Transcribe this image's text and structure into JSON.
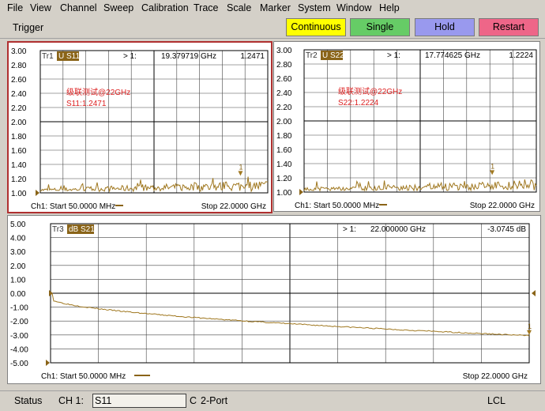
{
  "menu": [
    "File",
    "View",
    "Channel",
    "Sweep",
    "Calibration",
    "Trace",
    "Scale",
    "Marker",
    "System",
    "Window",
    "Help"
  ],
  "toolbar": {
    "trigger_label": "Trigger",
    "buttons": [
      {
        "label": "Continuous",
        "color": "#ffff00"
      },
      {
        "label": "Single",
        "color": "#66cc66"
      },
      {
        "label": "Hold",
        "color": "#9999ee"
      },
      {
        "label": "Restart",
        "color": "#ee6688"
      }
    ]
  },
  "panels": [
    {
      "trace_tag": "Tr1",
      "trace_label": "U S11",
      "marker_head": "> 1:",
      "marker_freq": "19.379719 GHz",
      "marker_val": "1.2471",
      "note_line1": "级联测试@22GHz",
      "note_line2": "S11:1.2471",
      "footer_left": "Ch1: Start  50.0000 MHz",
      "footer_right": "Stop  22.0000 GHz",
      "yticks": [
        "3.00",
        "2.80",
        "2.60",
        "2.40",
        "2.20",
        "2.00",
        "1.80",
        "1.60",
        "1.40",
        "1.20",
        "1.00"
      ],
      "marker_num": "1",
      "trace_color": "#a07820",
      "accent_color": "#8a6418"
    },
    {
      "trace_tag": "Tr2",
      "trace_label": "U S22",
      "marker_head": "> 1:",
      "marker_freq": "17.774625 GHz",
      "marker_val": "1.2224",
      "note_line1": "级联测试@22GHz",
      "note_line2": "S22:1.2224",
      "footer_left": "Ch1: Start  50.0000 MHz",
      "footer_right": "Stop  22.0000 GHz",
      "yticks": [
        "3.00",
        "2.80",
        "2.60",
        "2.40",
        "2.20",
        "2.00",
        "1.80",
        "1.60",
        "1.40",
        "1.20",
        "1.00"
      ],
      "marker_num": "1",
      "trace_color": "#a07820",
      "accent_color": "#8a6418"
    },
    {
      "trace_tag": "Tr3",
      "trace_label": "dB S21",
      "marker_head": "> 1:",
      "marker_freq": "22.000000 GHz",
      "marker_val": "-3.0745 dB",
      "footer_left": "Ch1: Start  50.0000 MHz",
      "footer_right": "Stop  22.0000 GHz",
      "yticks": [
        "5.00",
        "4.00",
        "3.00",
        "2.00",
        "1.00",
        "0.00",
        "-1.00",
        "-2.00",
        "-3.00",
        "-4.00",
        "-5.00"
      ],
      "marker_num": "1",
      "trace_color": "#a07820",
      "accent_color": "#8a6418"
    }
  ],
  "status": {
    "label": "Status",
    "channel": "CH 1:",
    "param": "S11",
    "cal": "C",
    "port": "2-Port",
    "mode": "LCL"
  }
}
